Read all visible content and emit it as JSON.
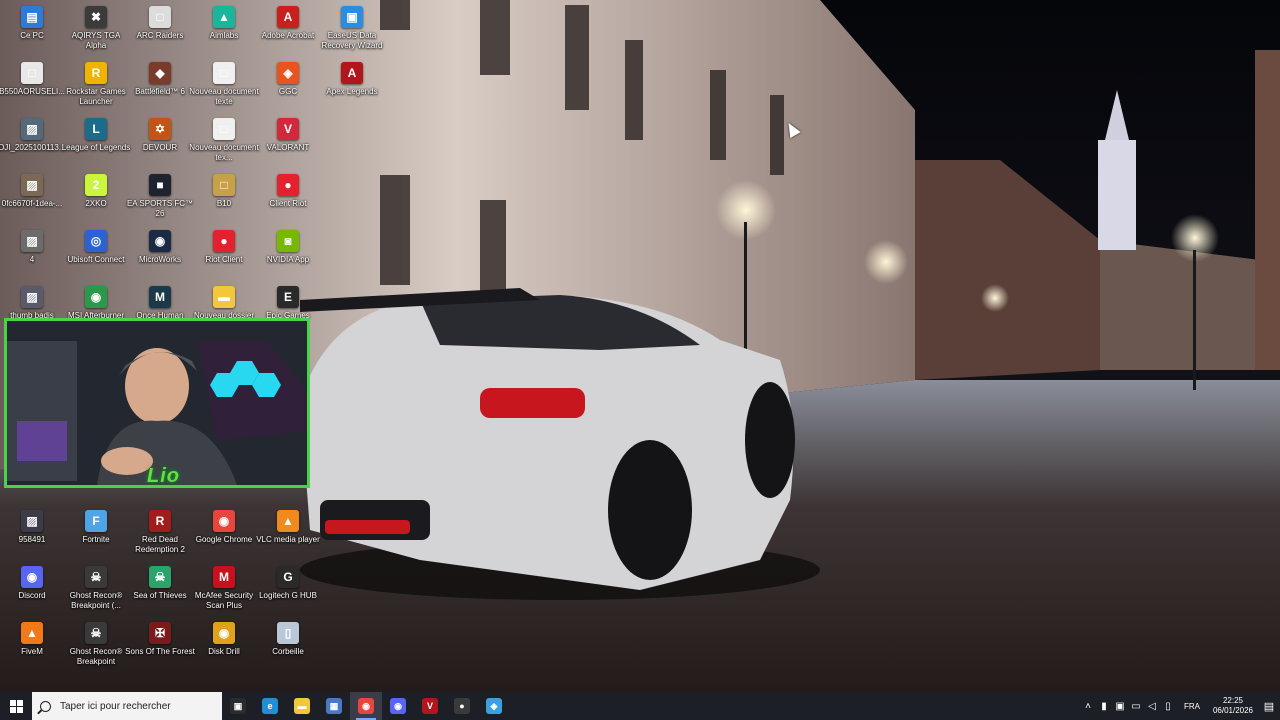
{
  "desktop": {
    "icons": [
      {
        "label": "Ce PC",
        "glyph": "▤",
        "color": "#2e7bd6"
      },
      {
        "label": "AQIRYS TGA Alpha",
        "glyph": "✖",
        "color": "#3b3b3b"
      },
      {
        "label": "ARC Raiders",
        "glyph": "□",
        "color": "#dcdcdc"
      },
      {
        "label": "Aimlabs",
        "glyph": "▲",
        "color": "#19b69b"
      },
      {
        "label": "Adobe Acrobat",
        "glyph": "A",
        "color": "#c8201c"
      },
      {
        "label": "EaseUS Data Recovery Wizard",
        "glyph": "▣",
        "color": "#2b8de0"
      },
      {
        "label": "B550AORUSELI...",
        "glyph": "□",
        "color": "#e8e8e8"
      },
      {
        "label": "Rockstar Games Launcher",
        "glyph": "R",
        "color": "#f2b200"
      },
      {
        "label": "Battlefield™ 6",
        "glyph": "◆",
        "color": "#7a3b2a"
      },
      {
        "label": "Nouveau document texte",
        "glyph": "□",
        "color": "#f0f0f0"
      },
      {
        "label": "GGC",
        "glyph": "◈",
        "color": "#e8541f"
      },
      {
        "label": "Apex Legends",
        "glyph": "A",
        "color": "#b0161c"
      },
      {
        "label": "DJI_2025100113...",
        "glyph": "▨",
        "color": "#546a7a"
      },
      {
        "label": "League of Legends",
        "glyph": "L",
        "color": "#1c6b8a"
      },
      {
        "label": "DEVOUR",
        "glyph": "✡",
        "color": "#c45316"
      },
      {
        "label": "Nouveau document tex...",
        "glyph": "□",
        "color": "#f0f0f0"
      },
      {
        "label": "VALORANT",
        "glyph": "V",
        "color": "#d1283b"
      },
      {
        "label": "0fc6670f-1dea-...",
        "glyph": "▨",
        "color": "#7a6a55"
      },
      {
        "label": "2XKO",
        "glyph": "2",
        "color": "#c9f53a"
      },
      {
        "label": "EA SPORTS FC™ 26",
        "glyph": "■",
        "color": "#1d2430"
      },
      {
        "label": "B10",
        "glyph": "□",
        "color": "#c8a048"
      },
      {
        "label": "Client Riot",
        "glyph": "●",
        "color": "#e3212f"
      },
      {
        "label": "4",
        "glyph": "▨",
        "color": "#6c6c6c"
      },
      {
        "label": "Ubisoft Connect",
        "glyph": "◎",
        "color": "#2c62d6"
      },
      {
        "label": "MicroWorks",
        "glyph": "◉",
        "color": "#1b2a45"
      },
      {
        "label": "Riot Client",
        "glyph": "●",
        "color": "#e3212f"
      },
      {
        "label": "NVIDIA App",
        "glyph": "◙",
        "color": "#76b900"
      },
      {
        "label": "thumb badis",
        "glyph": "▨",
        "color": "#5a5a6a"
      },
      {
        "label": "MSI Afterburner",
        "glyph": "◉",
        "color": "#2a9a4a"
      },
      {
        "label": "Once Human",
        "glyph": "M",
        "color": "#1a3a4a"
      },
      {
        "label": "Nouveau dossier",
        "glyph": "▬",
        "color": "#f3c73c"
      },
      {
        "label": "Epic Games Launcher",
        "glyph": "E",
        "color": "#2a2a2a"
      },
      {
        "label": "958491",
        "glyph": "▨",
        "color": "#3b3b4a"
      },
      {
        "label": "Fortnite",
        "glyph": "F",
        "color": "#4fa4e6"
      },
      {
        "label": "Red Dead Redemption 2",
        "glyph": "R",
        "color": "#a21c1c"
      },
      {
        "label": "Google Chrome",
        "glyph": "◉",
        "color": "#e8453c"
      },
      {
        "label": "VLC media player",
        "glyph": "▲",
        "color": "#f08a1c"
      },
      {
        "label": "Discord",
        "glyph": "◉",
        "color": "#5865f2"
      },
      {
        "label": "Ghost Recon® Breakpoint (...",
        "glyph": "☠",
        "color": "#3a3a3a"
      },
      {
        "label": "Sea of Thieves",
        "glyph": "☠",
        "color": "#2aa46a"
      },
      {
        "label": "McAfee Security Scan Plus",
        "glyph": "M",
        "color": "#c8101e"
      },
      {
        "label": "Logitech G HUB",
        "glyph": "G",
        "color": "#2a2a2a"
      },
      {
        "label": "FiveM",
        "glyph": "▲",
        "color": "#f07a1a"
      },
      {
        "label": "Ghost Recon® Breakpoint",
        "glyph": "☠",
        "color": "#3a3a3a"
      },
      {
        "label": "Sons Of The Forest",
        "glyph": "✠",
        "color": "#7a1a1a"
      },
      {
        "label": "Disk Drill",
        "glyph": "◉",
        "color": "#e0a21a"
      },
      {
        "label": "Corbeille",
        "glyph": "▯",
        "color": "#b8c8d8"
      }
    ]
  },
  "webcam": {
    "overlay_text": "Lio"
  },
  "taskbar": {
    "search_placeholder": "Taper ici pour rechercher",
    "apps": [
      {
        "name": "task-view",
        "glyph": "▣",
        "color": "#2b2b2b"
      },
      {
        "name": "edge",
        "glyph": "e",
        "color": "#1f8fd6"
      },
      {
        "name": "file-explorer",
        "glyph": "▬",
        "color": "#f3c73c"
      },
      {
        "name": "store",
        "glyph": "▦",
        "color": "#4a78c8"
      },
      {
        "name": "chrome",
        "glyph": "◉",
        "color": "#e8453c",
        "active": true
      },
      {
        "name": "discord",
        "glyph": "◉",
        "color": "#5865f2"
      },
      {
        "name": "voicemeeter",
        "glyph": "V",
        "color": "#b3151f"
      },
      {
        "name": "obs",
        "glyph": "●",
        "color": "#3a3a3a"
      },
      {
        "name": "app-blue",
        "glyph": "◈",
        "color": "#3aa0e0"
      }
    ],
    "tray": {
      "language": "FRA",
      "time": "22:25",
      "date": "06/01/2026"
    }
  }
}
